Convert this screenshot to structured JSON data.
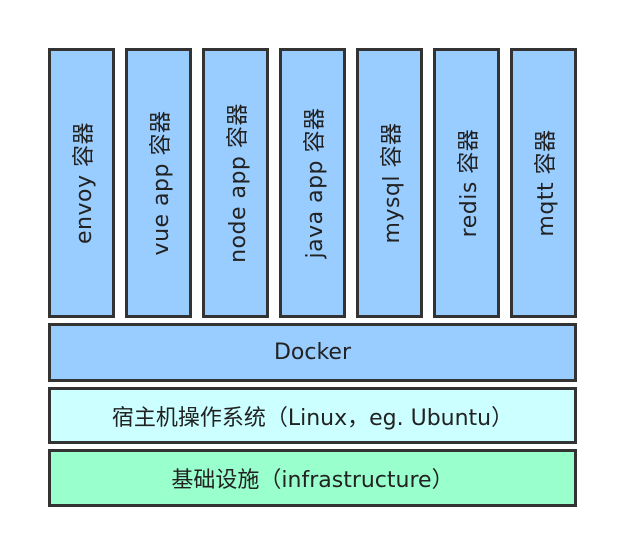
{
  "containers": [
    {
      "label": "envoy 容器"
    },
    {
      "label": "vue app 容器"
    },
    {
      "label": "node app 容器"
    },
    {
      "label": "java app 容器"
    },
    {
      "label": "mysql 容器"
    },
    {
      "label": "redis 容器"
    },
    {
      "label": "mqtt 容器"
    }
  ],
  "layers": {
    "docker": {
      "label": "Docker"
    },
    "os": {
      "label": "宿主机操作系统（Linux，eg. Ubuntu）"
    },
    "infra": {
      "label": "基础设施（infrastructure）"
    }
  },
  "colors": {
    "container_fill": "#99ccff",
    "docker_fill": "#99ccff",
    "os_fill": "#ccffff",
    "infra_fill": "#99ffcc",
    "border": "#333333"
  }
}
